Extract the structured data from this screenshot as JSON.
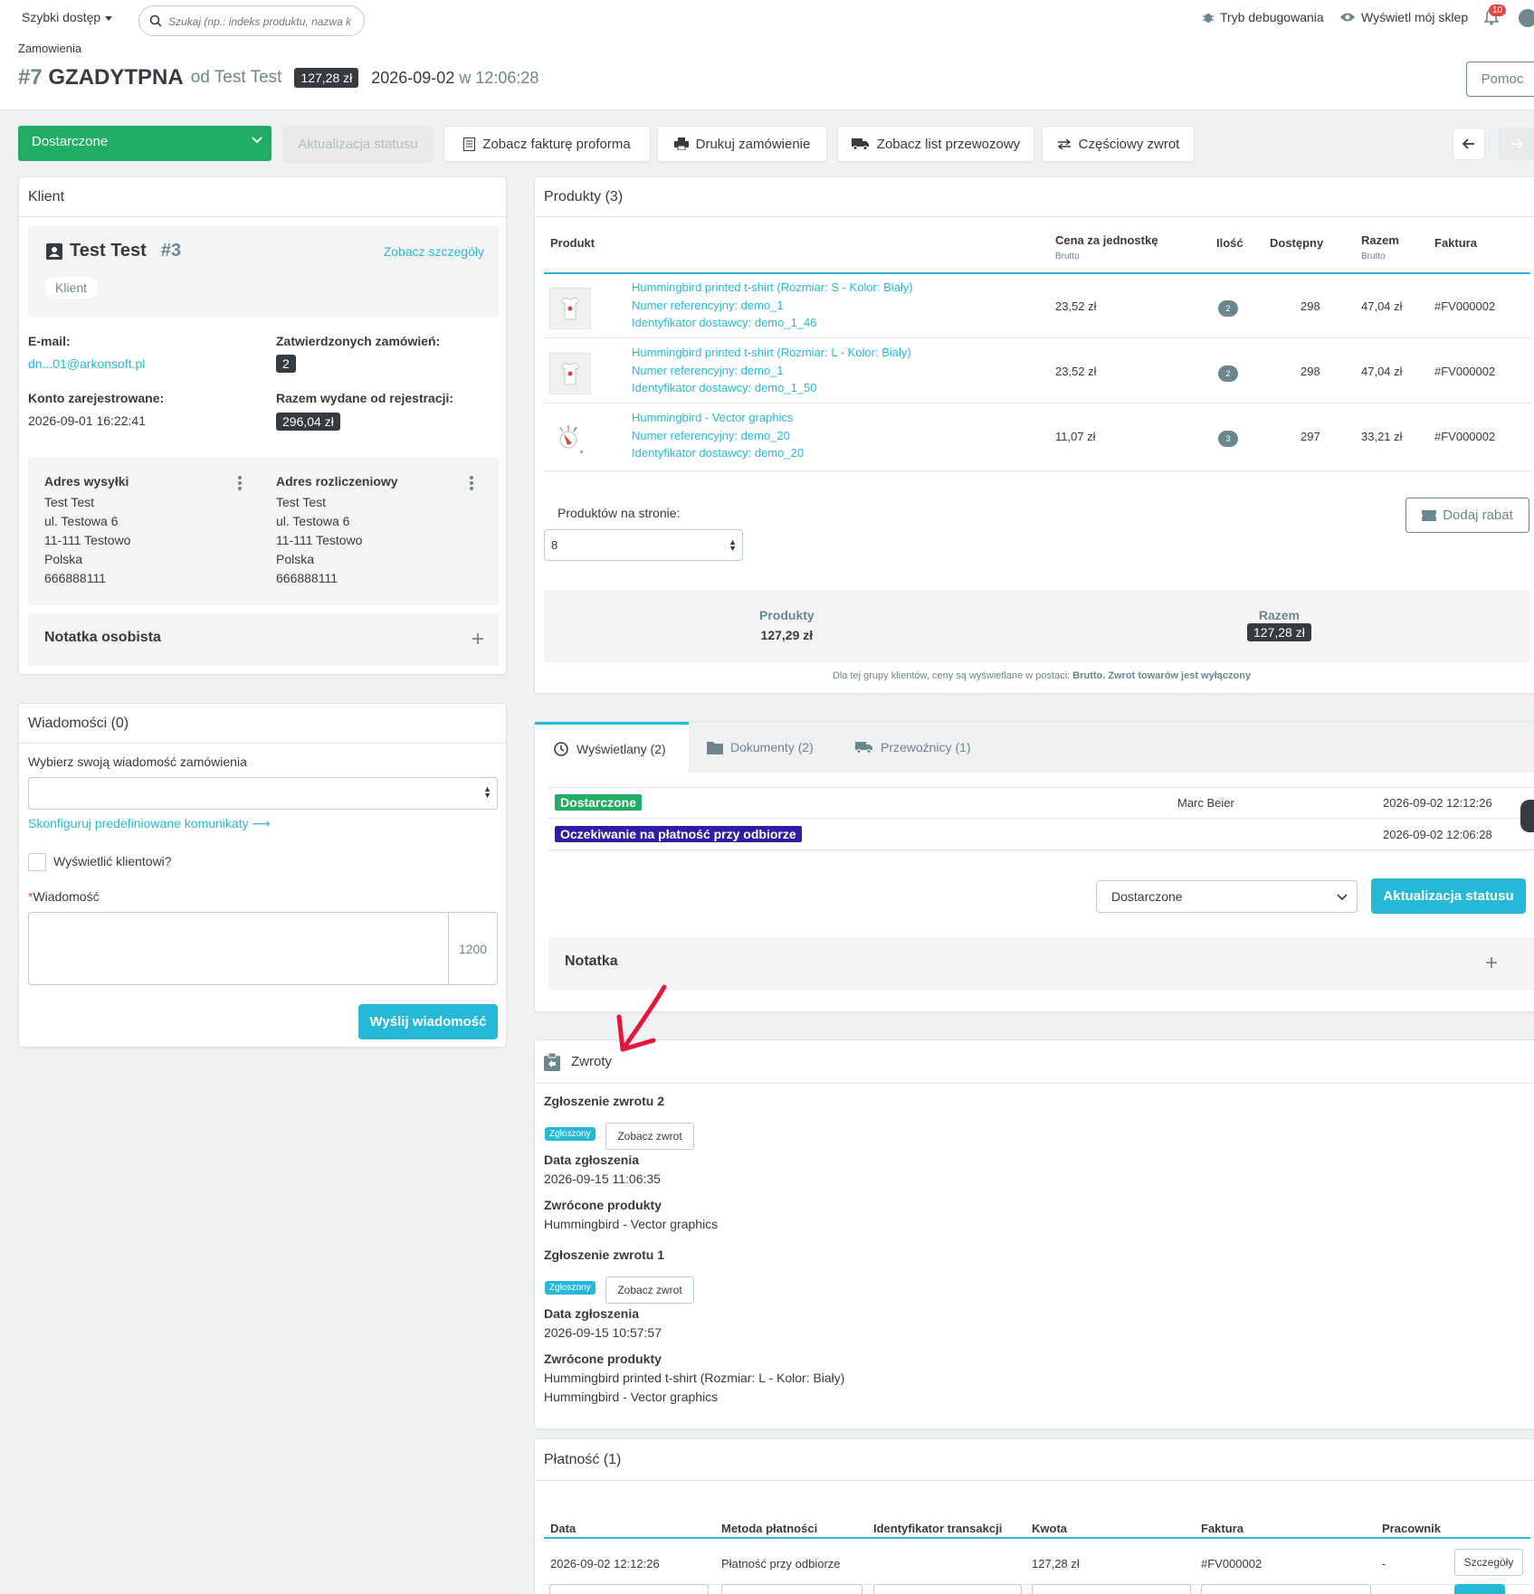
{
  "header": {
    "quick_access": "Szybki dostęp",
    "search_placeholder": "Szukaj (np.: indeks produktu, nazwa k",
    "debug_mode": "Tryb debugowania",
    "view_shop": "Wyświetl mój sklep",
    "notifications_count": "10",
    "breadcrumb": "Zamowienia",
    "order_hash": "#7",
    "order_reference": "GZADYTPNA",
    "order_from": "od Test Test",
    "order_total": "127,28 zł",
    "order_date": "2026-09-02",
    "order_time_prefix": "w",
    "order_time": "12:06:28",
    "help_button": "Pomoc"
  },
  "toolbar": {
    "status_value": "Dostarczone",
    "update_status": "Aktualizacja statusu",
    "view_proforma": "Zobacz fakturę proforma",
    "print_order": "Drukuj zamówienie",
    "view_waybill": "Zobacz list przewozowy",
    "partial_refund": "Częściowy zwrot"
  },
  "client": {
    "header": "Klient",
    "name": "Test Test",
    "id": "#3",
    "view_details": "Zobacz szczegóły",
    "tag": "Klient",
    "email_label": "E-mail:",
    "email": "dn...01@arkonsoft.pl",
    "validated_orders_label": "Zatwierdzonych zamówień:",
    "validated_orders": "2",
    "registered_label": "Konto zarejestrowane:",
    "registered": "2026-09-01 16:22:41",
    "spent_label": "Razem wydane od rejestracji:",
    "spent": "296,04 zł",
    "shipping": {
      "title": "Adres wysyłki",
      "lines": [
        "Test Test",
        "ul. Testowa 6",
        "11-111 Testowo",
        "Polska",
        "666888111"
      ]
    },
    "billing": {
      "title": "Adres rozliczeniowy",
      "lines": [
        "Test Test",
        "ul. Testowa 6",
        "11-111 Testowo",
        "Polska",
        "666888111"
      ]
    },
    "private_note": "Notatka osobista"
  },
  "messages": {
    "header": "Wiadomości (0)",
    "choose_label": "Wybierz swoją wiadomość zamówienia",
    "configure_link": "Skonfiguruj predefiniowane komunikaty",
    "display_to_customer": "Wyświetlić klientowi?",
    "message_required": "*",
    "message_label": "Wiadomość",
    "char_counter": "1200",
    "send_button": "Wyślij wiadomość"
  },
  "products": {
    "header": "Produkty (3)",
    "columns": {
      "product": "Produkt",
      "unit_price": "Cena za jednostkę",
      "unit_price_sub": "Brutto",
      "quantity": "Ilość",
      "available": "Dostępny",
      "total": "Razem",
      "total_sub": "Brutto",
      "invoice": "Faktura"
    },
    "rows": [
      {
        "name": "Hummingbird printed t-shirt (Rozmiar: S - Kolor: Biały)",
        "reference": "Numer referencyjny: demo_1",
        "supplier": "Identyfikator dostawcy: demo_1_46",
        "price": "23,52 zł",
        "qty": "2",
        "available": "298",
        "total": "47,04 zł",
        "invoice": "#FV000002"
      },
      {
        "name": "Hummingbird printed t-shirt (Rozmiar: L - Kolor: Biały)",
        "reference": "Numer referencyjny: demo_1",
        "supplier": "Identyfikator dostawcy: demo_1_50",
        "price": "23,52 zł",
        "qty": "2",
        "available": "298",
        "total": "47,04 zł",
        "invoice": "#FV000002"
      },
      {
        "name": "Hummingbird - Vector graphics",
        "reference": "Numer referencyjny: demo_20",
        "supplier": "Identyfikator dostawcy: demo_20",
        "price": "11,07 zł",
        "qty": "3",
        "available": "297",
        "total": "33,21 zł",
        "invoice": "#FV000002"
      }
    ],
    "per_page_label": "Produktów na stronie:",
    "per_page_value": "8",
    "add_discount": "Dodaj rabat",
    "summary_products_label": "Produkty",
    "summary_products_value": "127,29 zł",
    "summary_total_label": "Razem",
    "summary_total_value": "127,28 zł",
    "footnote_prefix": "Dla tej grupy klientów, ceny są wyświetlane w postaci:",
    "footnote_gross": "Brutto.",
    "footnote_returns": "Zwrot towarów jest wyłączony"
  },
  "history": {
    "tabs": [
      "Wyświetlany (2)",
      "Dokumenty (2)",
      "Przewoźnicy (1)"
    ],
    "entries": [
      {
        "status": "Dostarczone",
        "color": "#21ad63",
        "employee": "Marc Beier",
        "date": "2026-09-02 12:12:26"
      },
      {
        "status": "Oczekiwanie na płatność przy odbiorze",
        "color": "#2c1fa3",
        "employee": "",
        "date": "2026-09-02 12:06:28"
      }
    ],
    "status_select": "Dostarczone",
    "update_button": "Aktualizacja statusu",
    "note": "Notatka"
  },
  "returns": {
    "header": "Zwroty",
    "items": [
      {
        "title": "Zgłoszenie zwrotu 2",
        "badge": "Zgłoszony",
        "view": "Zobacz zwrot",
        "date_label": "Data zgłoszenia",
        "date": "2026-09-15 11:06:35",
        "products_label": "Zwrócone produkty",
        "products": [
          "Hummingbird - Vector graphics"
        ]
      },
      {
        "title": "Zgłoszenie zwrotu 1",
        "badge": "Zgłoszony",
        "view": "Zobacz zwrot",
        "date_label": "Data zgłoszenia",
        "date": "2026-09-15 10:57:57",
        "products_label": "Zwrócone produkty",
        "products": [
          "Hummingbird printed t-shirt (Rozmiar: L - Kolor: Biały)",
          "Hummingbird - Vector graphics"
        ]
      }
    ]
  },
  "payment": {
    "header": "Płatność (1)",
    "columns": [
      "Data",
      "Metoda płatności",
      "Identyfikator transakcji",
      "Kwota",
      "Faktura",
      "Pracownik"
    ],
    "row": {
      "date": "2026-09-02 12:12:26",
      "method": "Płatność przy odbiorze",
      "transaction": "",
      "amount": "127,28 zł",
      "invoice": "#FV000002",
      "employee": "-",
      "details": "Szczegóły"
    }
  },
  "colors": {
    "accent": "#25b9d7",
    "success": "#21ad63",
    "dark": "#363a41",
    "annotation": "#e3163b"
  }
}
